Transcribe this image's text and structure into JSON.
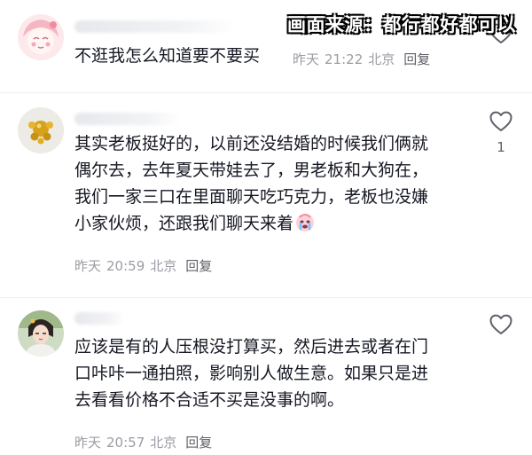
{
  "overlay": {
    "source_text": "画面来源：都行都好都可以"
  },
  "comments": [
    {
      "text": "不逛我怎么知道要不要买",
      "date": "昨天",
      "time": "21:22",
      "location": "北京",
      "reply_label": "回复",
      "likes": ""
    },
    {
      "text": "其实老板挺好的，以前还没结婚的时候我们俩就偶尔去，去年夏天带娃去了，男老板和大狗在，我们一家三口在里面聊天吃巧克力，老板也没嫌小家伙烦，还跟我们聊天来着",
      "date": "昨天",
      "time": "20:59",
      "location": "北京",
      "reply_label": "回复",
      "likes": "1"
    },
    {
      "text": "应该是有的人压根没打算买，然后进去或者在门口咔咔一通拍照，影响别人做生意。如果只是进去看看价格不合适不买是没事的啊。",
      "date": "昨天",
      "time": "20:57",
      "location": "北京",
      "reply_label": "回复",
      "likes": ""
    }
  ],
  "colors": {
    "text": "#161823",
    "meta": "#9b9ca3",
    "reply": "#5f6068"
  }
}
